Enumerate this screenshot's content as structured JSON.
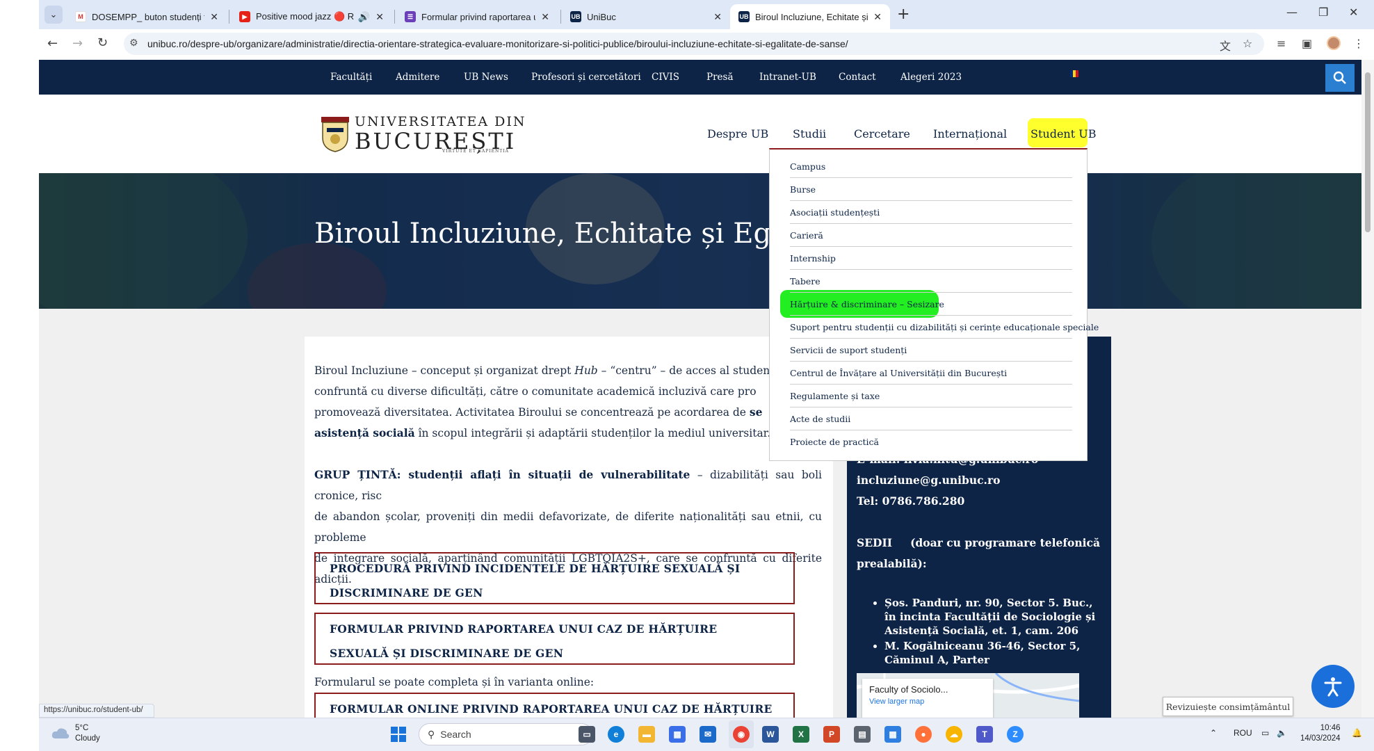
{
  "browser": {
    "tabs": [
      {
        "title": "DOSEMPP_ buton studenți form",
        "favicon": "gmail-icon",
        "active": false
      },
      {
        "title": "Positive mood jazz 🔴 Relaxi",
        "favicon": "youtube-icon",
        "active": false
      },
      {
        "title": "Formular privind raportarea uni",
        "favicon": "forms-icon",
        "active": false
      },
      {
        "title": "UniBuc",
        "favicon": "unibuc-icon",
        "active": false
      },
      {
        "title": "Biroul Incluziune, Echitate și Eg",
        "favicon": "unibuc-icon",
        "active": true
      }
    ],
    "url": "unibuc.ro/despre-ub/organizare/administratie/directia-orientare-strategica-evaluare-monitorizare-si-politici-publice/biroului-incluziune-echitate-si-egalitate-de-sanse/",
    "status_url": "https://unibuc.ro/student-ub/"
  },
  "site": {
    "top_nav": [
      "Facultăți",
      "Admitere",
      "UB News",
      "Profesori și cercetători",
      "CIVIS",
      "Presă",
      "Intranet-UB",
      "Contact",
      "Alegeri 2023"
    ],
    "logo": {
      "line1": "UNIVERSITATEA DIN",
      "line2": "BUCUREȘTI",
      "motto": "VIRTUTE ET SAPIENTIA"
    },
    "main_nav": [
      "Despre UB",
      "Studii",
      "Cercetare",
      "Internațional",
      "Student UB"
    ],
    "hero_title": "Biroul Incluziune, Echitate și Egalit",
    "dropdown": [
      "Campus",
      "Burse",
      "Asociații studențești",
      "Carieră",
      "Internship",
      "Tabere",
      "Hărțuire & discriminare – Sesizare",
      "Suport pentru studenții cu dizabilități și cerințe educaționale speciale",
      "Servicii de suport studenți",
      "Centrul de Învățare al Universității din București",
      "Regulamente și taxe",
      "Acte de studii",
      "Proiecte de practică"
    ],
    "content": {
      "p1_a": "Biroul Incluziune – conceput și organizat drept ",
      "p1_hub": "Hub",
      "p1_b": " – “centru” – de acces al studenți",
      "p1_line2": "confruntă cu diverse dificultăți, către o comunitate academică incluzivă care pro",
      "p1_line3_a": "promovează diversitatea. Activitatea Biroului se concentrează pe acordarea de ",
      "p1_line3_b": "se",
      "p1_line4_a": "asistență socială",
      "p1_line4_b": " în scopul integrării și adaptării studenților la mediul universitar.",
      "p2_bold": "GRUP ȚINTĂ: studenții aflați în situații de vulnerabilitate",
      "p2_a": " – dizabilități sau boli cronice, risc",
      "p2_line2": "de abandon școlar, proveniți din medii defavorizate, de diferite naționalități sau etnii, cu probleme",
      "p2_line3": "de integrare socială, aparținând comunității LGBTQIA2S+, care se confruntă cu diferite adicții.",
      "box1": "PROCEDURĂ PRIVIND INCIDENTELE DE HĂRȚUIRE SEXUALĂ ȘI DISCRIMINARE DE GEN",
      "box2": "FORMULAR PRIVIND RAPORTAREA UNUI CAZ DE HĂRȚUIRE SEXUALĂ ȘI DISCRIMINARE DE GEN",
      "online_note": "Formularul se poate completa și în varianta online:",
      "box3": "FORMULAR ONLINE PRIVIND RAPORTAREA UNUI CAZ DE HĂRȚUIRE"
    },
    "sidebar": {
      "email_partial": "E-mail: ilvia.hitu@g.unibuc.ro",
      "email2": "incluziune@g.unibuc.ro",
      "tel": "Tel: 0786.786.280",
      "sedii_a": "SEDII",
      "sedii_b": " (doar cu programare telefonică",
      "sedii_line2": "prealabilă):",
      "locations": [
        "Șos. Panduri, nr. 90, Sector 5. Buc., în incinta Facultății de Sociologie și Asistență Socială, et. 1, cam. 206",
        "M. Kogălniceanu 36-46, Sector 5, Căminul A, Parter"
      ],
      "map_title": "Faculty of Sociolo...",
      "map_link": "View larger map"
    },
    "consent_button": "Revizuiește consimțământul"
  },
  "taskbar": {
    "weather_temp": "5°C",
    "weather_desc": "Cloudy",
    "search_placeholder": "Search",
    "language": "ROU",
    "time": "10:46",
    "date": "14/03/2024"
  },
  "colors": {
    "navy": "#0d2446",
    "accent_red": "#8c1b1b",
    "highlight_yellow": "#ffff2e",
    "highlight_green": "#22ee22",
    "a11y_blue": "#1a6fdb"
  }
}
